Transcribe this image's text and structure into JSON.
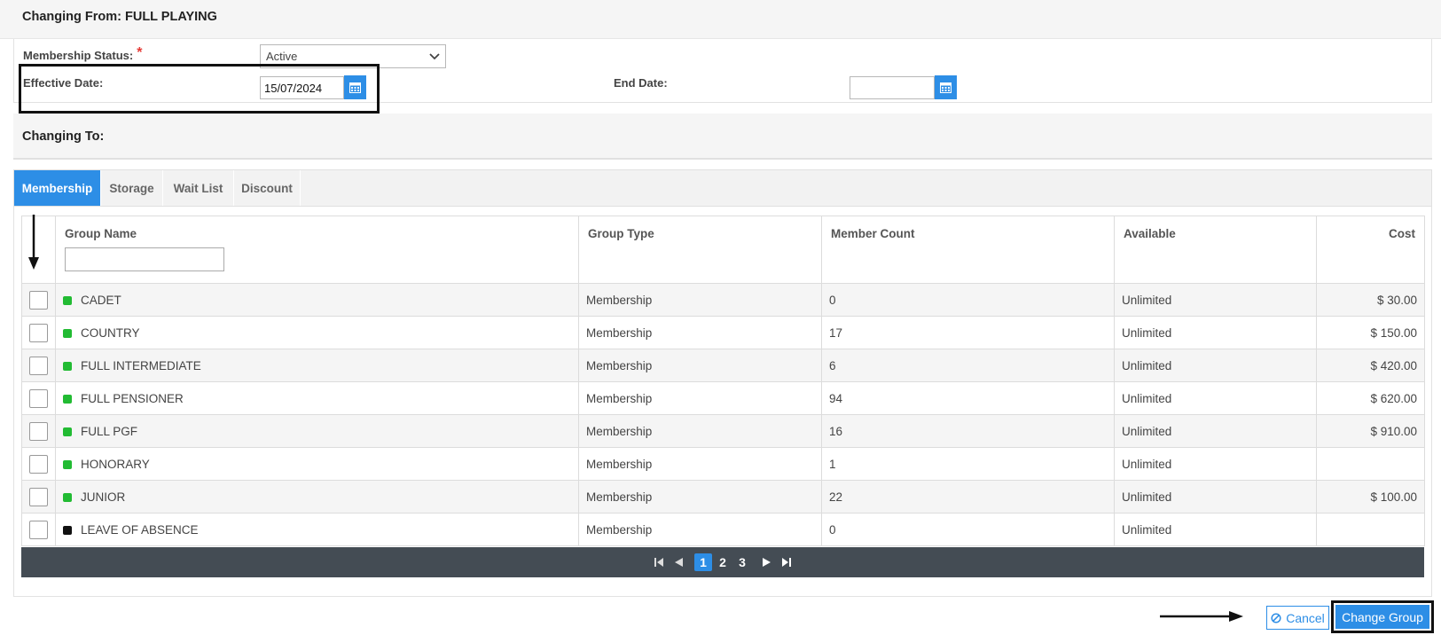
{
  "changing_from": {
    "title": "Changing From: FULL PLAYING"
  },
  "form": {
    "status_label": "Membership Status:",
    "required_mark": "*",
    "status_value": "Active",
    "effective_label": "Effective Date:",
    "effective_value": "15/07/2024",
    "end_label": "End Date:",
    "end_value": ""
  },
  "changing_to": {
    "title": "Changing To:"
  },
  "tabs": [
    {
      "label": "Membership",
      "active": true
    },
    {
      "label": "Storage",
      "active": false
    },
    {
      "label": "Wait List",
      "active": false
    },
    {
      "label": "Discount",
      "active": false
    }
  ],
  "table": {
    "columns": [
      "Group Name",
      "Group Type",
      "Member Count",
      "Available",
      "Cost"
    ],
    "filter_placeholder": "",
    "rows": [
      {
        "name": "CADET",
        "type": "Membership",
        "count": "0",
        "available": "Unlimited",
        "cost": "$ 30.00",
        "color": "#22bb33"
      },
      {
        "name": "COUNTRY",
        "type": "Membership",
        "count": "17",
        "available": "Unlimited",
        "cost": "$ 150.00",
        "color": "#22bb33"
      },
      {
        "name": "FULL INTERMEDIATE",
        "type": "Membership",
        "count": "6",
        "available": "Unlimited",
        "cost": "$ 420.00",
        "color": "#22bb33"
      },
      {
        "name": "FULL PENSIONER",
        "type": "Membership",
        "count": "94",
        "available": "Unlimited",
        "cost": "$ 620.00",
        "color": "#22bb33"
      },
      {
        "name": "FULL PGF",
        "type": "Membership",
        "count": "16",
        "available": "Unlimited",
        "cost": "$ 910.00",
        "color": "#22bb33"
      },
      {
        "name": "HONORARY",
        "type": "Membership",
        "count": "1",
        "available": "Unlimited",
        "cost": "",
        "color": "#22bb33"
      },
      {
        "name": "JUNIOR",
        "type": "Membership",
        "count": "22",
        "available": "Unlimited",
        "cost": "$ 100.00",
        "color": "#22bb33"
      },
      {
        "name": "LEAVE OF ABSENCE",
        "type": "Membership",
        "count": "0",
        "available": "Unlimited",
        "cost": "",
        "color": "#111111"
      }
    ]
  },
  "pager": {
    "pages": [
      "1",
      "2",
      "3"
    ],
    "current": "1"
  },
  "actions": {
    "cancel_label": "Cancel",
    "submit_label": "Change Group"
  },
  "colors": {
    "accent": "#2d8ee6",
    "pager_bg": "#444c54"
  }
}
